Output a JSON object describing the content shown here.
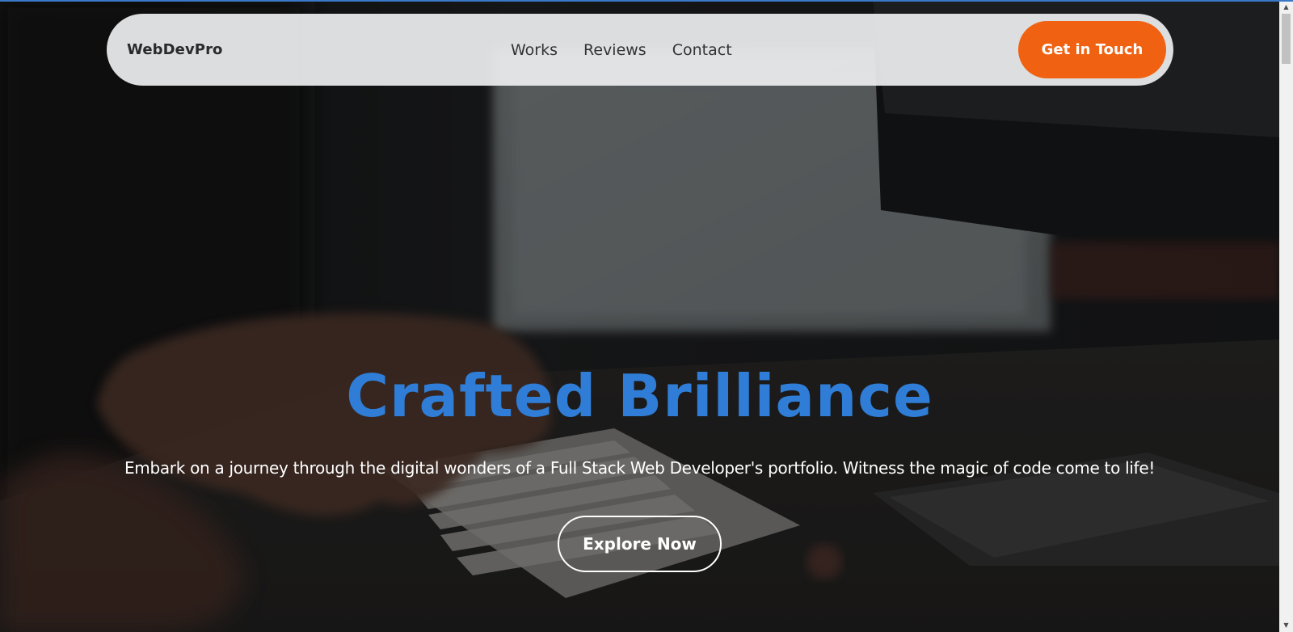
{
  "navbar": {
    "brand": "WebDevPro",
    "links": [
      "Works",
      "Reviews",
      "Contact"
    ],
    "cta_label": "Get in Touch"
  },
  "hero": {
    "title": "Crafted Brilliance",
    "subtitle": "Embark on a journey through the digital wonders of a Full Stack Web Developer's portfolio. Witness the magic of code come to life!",
    "button_label": "Explore Now"
  },
  "colors": {
    "accent_orange": "#f06212",
    "title_blue": "#2f7dd6",
    "navbar_bg": "#ecedee"
  },
  "scrollbar": {
    "up_icon": "scroll-up-arrow-icon",
    "down_icon": "scroll-down-arrow-icon"
  }
}
